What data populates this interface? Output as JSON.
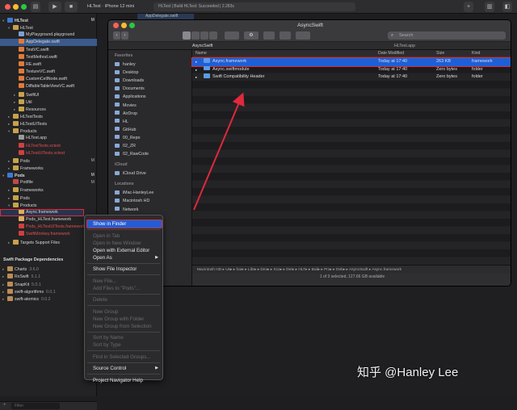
{
  "xcode": {
    "toolbar": {
      "play": "▶",
      "stop": "■",
      "scheme": "HLTest",
      "device": "iPhone 12 mini",
      "status": "HLTest | Build HLTest: Succeeded | 2.283s",
      "tab": "AppDelegate.swift"
    },
    "navigator": {
      "rows": [
        {
          "label": "HLTest",
          "level": 0,
          "disc": "▾",
          "icon": "#3b7ad6",
          "badge": "M",
          "cls": "sec"
        },
        {
          "label": "HLTest",
          "level": 1,
          "disc": "▾",
          "icon": "#c8a24a",
          "badge": ""
        },
        {
          "label": "MyPlayground.playground",
          "level": 2,
          "disc": "",
          "icon": "#7e9fd0",
          "badge": ""
        },
        {
          "label": "AppDelegate.swift",
          "level": 2,
          "disc": "",
          "icon": "#e07a3b",
          "badge": "",
          "cls": "sel"
        },
        {
          "label": "TestVC.swift",
          "level": 2,
          "disc": "",
          "icon": "#e07a3b",
          "badge": ""
        },
        {
          "label": "TestMethod.swift",
          "level": 2,
          "disc": "",
          "icon": "#e07a3b",
          "badge": ""
        },
        {
          "label": "RE.swift",
          "level": 2,
          "disc": "",
          "icon": "#e07a3b",
          "badge": ""
        },
        {
          "label": "TextureVC.swift",
          "level": 2,
          "disc": "",
          "icon": "#e07a3b",
          "badge": ""
        },
        {
          "label": "CustomCellNode.swift",
          "level": 2,
          "disc": "",
          "icon": "#e07a3b",
          "badge": ""
        },
        {
          "label": "DiffableTableViewVC.swift",
          "level": 2,
          "disc": "",
          "icon": "#e07a3b",
          "badge": ""
        },
        {
          "label": "SwiftUI",
          "level": 2,
          "disc": "▸",
          "icon": "#c8a24a",
          "badge": ""
        },
        {
          "label": "Util",
          "level": 2,
          "disc": "▸",
          "icon": "#c8a24a",
          "badge": ""
        },
        {
          "label": "Resources",
          "level": 2,
          "disc": "▸",
          "icon": "#c8a24a",
          "badge": ""
        },
        {
          "label": "HLTestTests",
          "level": 1,
          "disc": "▸",
          "icon": "#c8a24a",
          "badge": ""
        },
        {
          "label": "HLTestUITests",
          "level": 1,
          "disc": "▸",
          "icon": "#c8a24a",
          "badge": ""
        },
        {
          "label": "Products",
          "level": 1,
          "disc": "▾",
          "icon": "#c8a24a",
          "badge": ""
        },
        {
          "label": "HLTest.app",
          "level": 2,
          "disc": "",
          "icon": "#9a9a9a",
          "badge": ""
        },
        {
          "label": "HLTestTests.xctest",
          "level": 2,
          "disc": "",
          "icon": "#d04040",
          "badge": "",
          "color": "#e05050"
        },
        {
          "label": "HLTestUITests.xctest",
          "level": 2,
          "disc": "",
          "icon": "#d04040",
          "badge": "",
          "color": "#e05050"
        },
        {
          "label": "Pods",
          "level": 1,
          "disc": "▸",
          "icon": "#c8a24a",
          "badge": "M"
        },
        {
          "label": "Frameworks",
          "level": 1,
          "disc": "▸",
          "icon": "#c8a24a",
          "badge": ""
        },
        {
          "label": "Pods",
          "level": 0,
          "disc": "▾",
          "icon": "#3b7ad6",
          "badge": "M",
          "cls": "sec"
        },
        {
          "label": "Podfile",
          "level": 1,
          "disc": "",
          "icon": "#c04848",
          "badge": "M"
        },
        {
          "label": "Frameworks",
          "level": 1,
          "disc": "▸",
          "icon": "#c8a24a",
          "badge": ""
        },
        {
          "label": "Pods",
          "level": 1,
          "disc": "▸",
          "icon": "#c8a24a",
          "badge": ""
        },
        {
          "label": "Products",
          "level": 1,
          "disc": "▾",
          "icon": "#c8a24a",
          "badge": ""
        },
        {
          "label": "Async.framework",
          "level": 2,
          "disc": "",
          "icon": "#d8b060",
          "badge": "",
          "cls": "red"
        },
        {
          "label": "Pods_HLTest.framework",
          "level": 2,
          "disc": "",
          "icon": "#d8b060",
          "badge": ""
        },
        {
          "label": "Pods_HLTestUITests.framework",
          "level": 2,
          "disc": "",
          "icon": "#d04040",
          "badge": "",
          "color": "#e05050"
        },
        {
          "label": "SwiftMonkey.framework",
          "level": 2,
          "disc": "",
          "icon": "#d04040",
          "badge": "",
          "color": "#e05050"
        },
        {
          "label": "Targets Support Files",
          "level": 1,
          "disc": "▸",
          "icon": "#c8a24a",
          "badge": ""
        }
      ],
      "spm_title": "Swift Package Dependencies",
      "packages": [
        {
          "name": "Charts",
          "ver": "3.6.0"
        },
        {
          "name": "RxSwift",
          "ver": "5.1.1"
        },
        {
          "name": "SnapKit",
          "ver": "5.0.1"
        },
        {
          "name": "swift-algorithms",
          "ver": "0.0.1"
        },
        {
          "name": "swift-atomics",
          "ver": "0.0.2"
        }
      ],
      "filter_placeholder": "Filter"
    },
    "context_menu": [
      {
        "label": "Show in Finder",
        "state": "hl"
      },
      {
        "sep": true
      },
      {
        "label": "Open in Tab",
        "state": "dim"
      },
      {
        "label": "Open in New Window",
        "state": "dim"
      },
      {
        "label": "Open with External Editor",
        "state": ""
      },
      {
        "label": "Open As",
        "state": "",
        "sub": true
      },
      {
        "sep": true
      },
      {
        "label": "Show File Inspector",
        "state": ""
      },
      {
        "sep": true
      },
      {
        "label": "New File...",
        "state": "dim"
      },
      {
        "label": "Add Files to \"Pods\"...",
        "state": "dim"
      },
      {
        "sep": true
      },
      {
        "label": "Delete",
        "state": "dim"
      },
      {
        "sep": true
      },
      {
        "label": "New Group",
        "state": "dim"
      },
      {
        "label": "New Group with Folder",
        "state": "dim"
      },
      {
        "label": "New Group from Selection",
        "state": "dim"
      },
      {
        "sep": true
      },
      {
        "label": "Sort by Name",
        "state": "dim"
      },
      {
        "label": "Sort by Type",
        "state": "dim"
      },
      {
        "sep": true
      },
      {
        "label": "Find in Selected Groups...",
        "state": "dim"
      },
      {
        "sep": true
      },
      {
        "label": "Source Control",
        "state": "",
        "sub": true
      },
      {
        "sep": true
      },
      {
        "label": "Project Navigator Help",
        "state": ""
      }
    ]
  },
  "finder": {
    "title": "AsyncSwift",
    "search_placeholder": "Search",
    "tabs": [
      "AsyncSwift",
      "HLTest.app"
    ],
    "sidebar": {
      "favorites_header": "Favorites",
      "favorites": [
        "hanley",
        "Desktop",
        "Downloads",
        "Documents",
        "Applications",
        "Movies",
        "AirDrop",
        "HL",
        "GitHub",
        "00_Repo",
        "02_ZR",
        "02_RawCode"
      ],
      "icloud_header": "iCloud",
      "icloud": [
        "iCloud Drive"
      ],
      "locations_header": "Locations",
      "locations": [
        "iMac-HanleyLee",
        "Macintosh HD",
        "Network"
      ],
      "tags_header": "Tags"
    },
    "columns": {
      "name": "Name",
      "date": "Date Modified",
      "size": "Size",
      "kind": "Kind"
    },
    "items": [
      {
        "name": "Async.framework",
        "date": "Today at 17:40",
        "size": "263 KB",
        "kind": "framework"
      },
      {
        "name": "Async.swiftmodule",
        "date": "Today at 17:40",
        "size": "Zero bytes",
        "kind": "folder"
      },
      {
        "name": "Swift Compatibility Header",
        "date": "Today at 17:40",
        "size": "Zero bytes",
        "kind": "folder"
      }
    ],
    "path": "Macintosh HD  ▸  Us▸  ▸  har▸  ▸  Libr▸  ▸  Dev▸  ▸  Xco▸  ▸  Der▸  ▸  HLT▸  ▸  Buil▸  ▸  Pro▸  ▸  Deb▸  ▸  AsyncSwift  ▸  Async.framework",
    "status": "1 of 3 selected, 127.66 GB available"
  },
  "watermark": "知乎 @Hanley Lee"
}
